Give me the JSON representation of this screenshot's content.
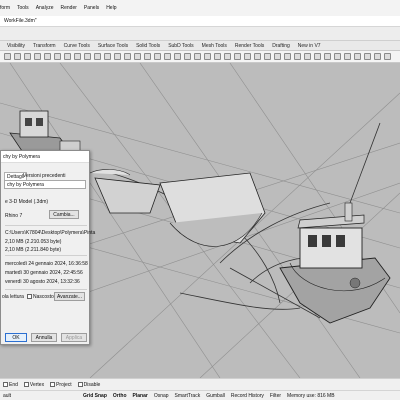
{
  "menu": [
    "form",
    "Tools",
    "Analyze",
    "Render",
    "Panels",
    "Help"
  ],
  "file_field": "WorkFile.3dm\"",
  "tabs": [
    "Visibility",
    "Transform",
    "Curve Tools",
    "Surface Tools",
    "Solid Tools",
    "SubD Tools",
    "Mesh Tools",
    "Render Tools",
    "Drafting",
    "New in V7"
  ],
  "dialog": {
    "title": "chy by Polymera",
    "name_value": "chy by Polymera",
    "tab_details": "Dettagli",
    "tab_versions": "Versioni precedenti",
    "open_with_label": "Rhino 7",
    "change_button": "Cambia...",
    "type_line": "e 3-D Model (.3dm)",
    "path": "C:\\Users\\K7804\\Desktop\\Polymera\\Pinta",
    "size": "2,10 MB (2.210.053 byte)",
    "size_on_disk": "2,10 MB (2.211.840 byte)",
    "created": "mercoledì 24 gennaio 2024, 16:36:58",
    "modified": "martedì 30 gennaio 2024, 22:45:56",
    "accessed": "venerdì 30 agosto 2024, 13:32:36",
    "readonly_label": "ola lettura",
    "hidden_label": "Nascosto",
    "advanced_button": "Avanzate...",
    "ok_button": "OK",
    "cancel_button": "Annulla",
    "apply_button": "Applica"
  },
  "snaps": [
    "End",
    "Vertex",
    "Project",
    "Disable"
  ],
  "status": {
    "layer": "ault",
    "grid_snap": "Grid Snap",
    "ortho": "Ortho",
    "planar": "Planar",
    "osnap": "Osnap",
    "smarttrack": "SmartTrack",
    "gumball": "Gumball",
    "record_history": "Record History",
    "filter": "Filter",
    "memory": "Memory use: 816 MB"
  }
}
